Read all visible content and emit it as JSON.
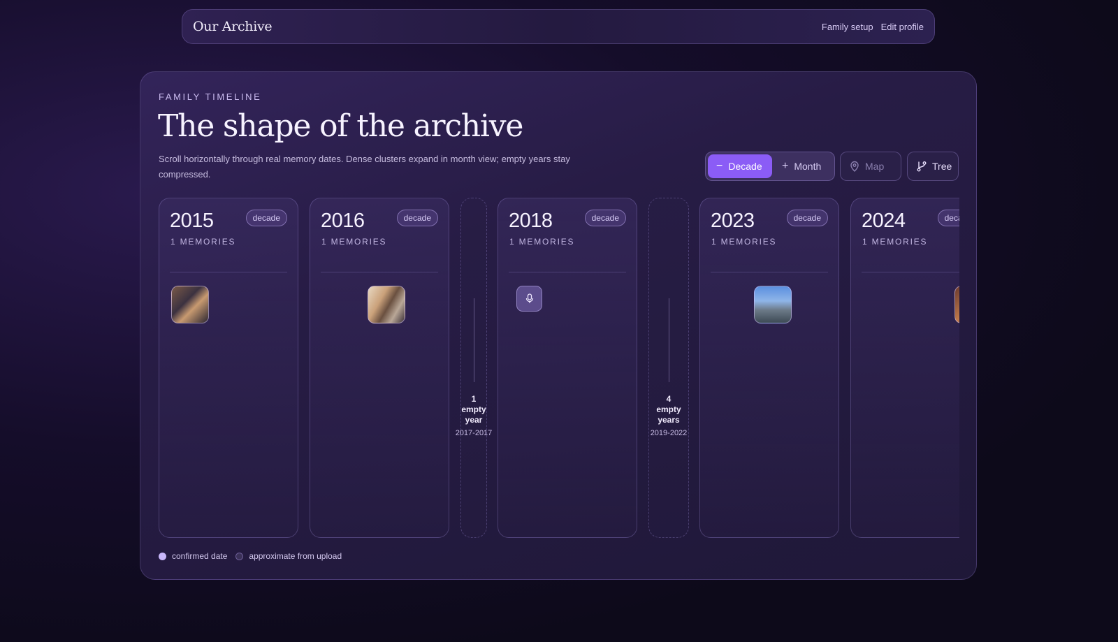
{
  "header": {
    "brand": "Our Archive",
    "nav": [
      {
        "label": "Family setup"
      },
      {
        "label": "Edit profile"
      }
    ]
  },
  "hero": {
    "eyebrow": "FAMILY TIMELINE",
    "title": "The shape of the archive",
    "description": "Scroll horizontally through real memory dates. Dense clusters expand in month view; empty years stay compressed."
  },
  "controls": {
    "zoom": [
      {
        "label": "Decade",
        "icon": "minus-icon",
        "active": true
      },
      {
        "label": "Month",
        "icon": "plus-icon",
        "active": false
      }
    ],
    "map_label": "Map",
    "tree_label": "Tree",
    "accent": "#8b5cf6"
  },
  "timeline": {
    "years": [
      {
        "year": "2015",
        "badge": "decade",
        "count": "1 MEMORIES",
        "item": "photo"
      },
      {
        "year": "2016",
        "badge": "decade",
        "count": "1 MEMORIES",
        "item": "photo"
      },
      {
        "year": "2018",
        "badge": "decade",
        "count": "1 MEMORIES",
        "item": "audio"
      },
      {
        "year": "2023",
        "badge": "decade",
        "count": "1 MEMORIES",
        "item": "photo"
      },
      {
        "year": "2024",
        "badge": "decade",
        "count": "1 MEMORIES",
        "item": "photo"
      }
    ],
    "gaps": [
      {
        "line1": "1",
        "line2": "empty",
        "line3": "year",
        "range": "2017-2017"
      },
      {
        "line1": "4",
        "line2": "empty",
        "line3": "years",
        "range": "2019-2022"
      }
    ]
  },
  "legend": {
    "confirmed": "confirmed date",
    "approximate": "approximate from upload"
  }
}
